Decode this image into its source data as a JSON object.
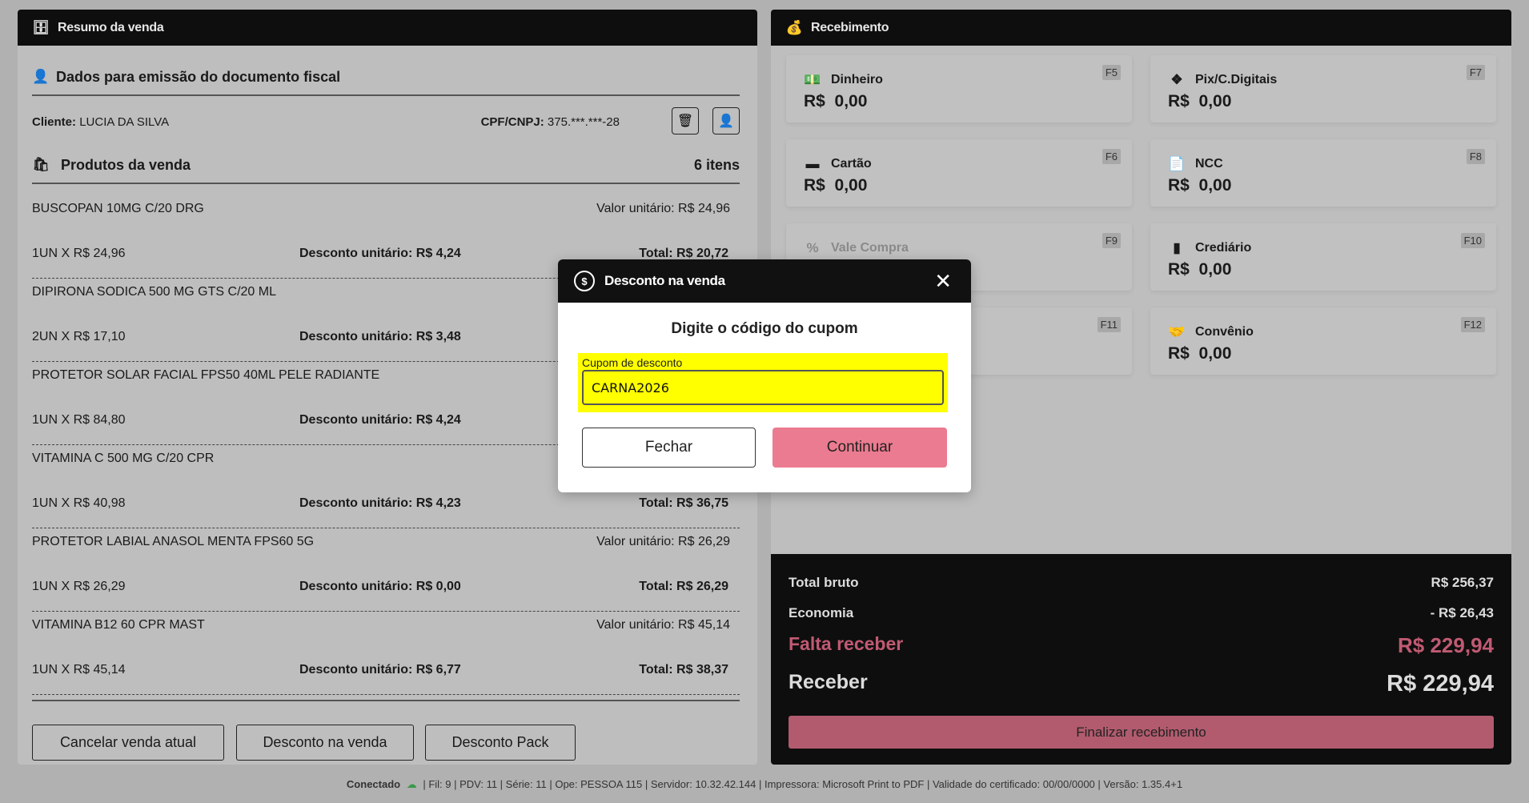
{
  "left": {
    "title": "Resumo da venda",
    "fiscal_title": "Dados para emissão do documento fiscal",
    "client_label": "Cliente:",
    "client_value": "LUCIA DA SILVA",
    "doc_label": "CPF/CNPJ:",
    "doc_value": "375.***.***-28",
    "products_title": "Produtos da venda",
    "items_count": "6 itens",
    "items": [
      {
        "name": "BUSCOPAN 10MG C/20 DRG",
        "unit": "Valor unitário: R$ 24,96",
        "qty": "1UN X R$ 24,96",
        "disc": "Desconto unitário: R$ 4,24",
        "total": "Total: R$ 20,72"
      },
      {
        "name": "DIPIRONA SODICA 500 MG GTS C/20 ML",
        "qty": "2UN X R$ 17,10",
        "disc": "Desconto unitário: R$ 3,48"
      },
      {
        "name": "PROTETOR SOLAR FACIAL FPS50 40ML PELE RADIANTE",
        "qty": "1UN X R$ 84,80",
        "disc": "Desconto unitário: R$ 4,24"
      },
      {
        "name": "VITAMINA C 500 MG C/20 CPR",
        "qty": "1UN X R$ 40,98",
        "disc": "Desconto unitário: R$ 4,23",
        "total": "Total: R$ 36,75"
      },
      {
        "name": "PROTETOR LABIAL ANASOL MENTA FPS60 5G",
        "unit": "Valor unitário: R$ 26,29",
        "qty": "1UN X R$ 26,29",
        "disc": "Desconto unitário: R$ 0,00",
        "total": "Total: R$ 26,29"
      },
      {
        "name": "VITAMINA B12 60 CPR MAST",
        "unit": "Valor unitário: R$ 45,14",
        "qty": "1UN X R$ 45,14",
        "disc": "Desconto unitário: R$ 6,77",
        "total": "Total: R$ 38,37"
      }
    ],
    "buttons": {
      "cancel": "Cancelar venda atual",
      "discount": "Desconto na venda",
      "pack": "Desconto Pack"
    }
  },
  "right": {
    "title": "Recebimento",
    "tiles": [
      {
        "label": "Dinheiro",
        "value": "R$  0,00",
        "key": "F5",
        "icon": "cash-icon"
      },
      {
        "label": "Pix/C.Digitais",
        "value": "R$  0,00",
        "key": "F7",
        "icon": "pix-icon"
      },
      {
        "label": "Cartão",
        "value": "R$  0,00",
        "key": "F6",
        "icon": "card-icon"
      },
      {
        "label": "NCC",
        "value": "R$  0,00",
        "key": "F8",
        "icon": "document-check-icon"
      },
      {
        "label": "Vale Compra",
        "key": "F9",
        "icon": "voucher-icon"
      },
      {
        "label": "Crediário",
        "value": "R$  0,00",
        "key": "F10",
        "icon": "wallet-icon"
      },
      {
        "key": "F11"
      },
      {
        "label": "Convênio",
        "value": "R$  0,00",
        "key": "F12",
        "icon": "handshake-icon"
      }
    ],
    "summary": {
      "gross_label": "Total bruto",
      "gross": "R$ 256,37",
      "savings_label": "Economia",
      "savings": "- R$ 26,43",
      "due_label": "Falta receber",
      "due": "R$ 229,94",
      "receive_label": "Receber",
      "receive": "R$ 229,94",
      "finish": "Finalizar recebimento"
    },
    "colors": {
      "accent": "#b25b6e",
      "due": "#c05a72"
    }
  },
  "modal": {
    "title": "Desconto na venda",
    "heading": "Digite o código do cupom",
    "field_label": "Cupom de desconto",
    "field_value": "CARNA2026",
    "close": "Fechar",
    "continue": "Continuar",
    "highlight": "#ffff00",
    "continue_color": "#eb7b90"
  },
  "status": {
    "connected": "Conectado",
    "details": "| Fil: 9 | PDV: 11 | Série: 11 | Ope: PESSOA 115 | Servidor: 10.32.42.144 | Impressora: Microsoft Print to PDF | Validade do certificado: 00/00/0000 | Versão: 1.35.4+1"
  }
}
